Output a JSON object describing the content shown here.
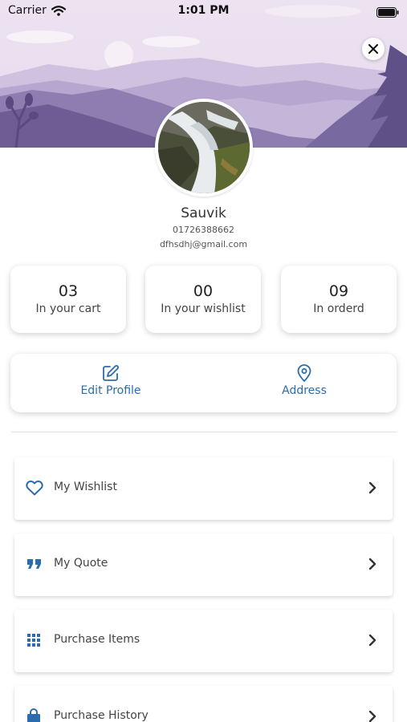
{
  "status_bar": {
    "carrier": "Carrier",
    "time": "1:01 PM",
    "icons": [
      "wifi-icon",
      "battery-icon"
    ]
  },
  "header": {
    "close_icon": "close-icon",
    "background": "mountain-landscape"
  },
  "profile": {
    "name": "Sauvik",
    "phone": "01726388662",
    "email": "dfhsdhj@gmail.com",
    "avatar": "waterfall-photo"
  },
  "stats": [
    {
      "count": "03",
      "label": "In your cart"
    },
    {
      "count": "00",
      "label": "In your wishlist"
    },
    {
      "count": "09",
      "label": "In orderd"
    }
  ],
  "actions": [
    {
      "label": "Edit Profile",
      "icon": "edit-icon"
    },
    {
      "label": "Address",
      "icon": "location-pin-icon"
    }
  ],
  "menu": [
    {
      "label": "My Wishlist",
      "icon": "heart-icon"
    },
    {
      "label": "My Quote",
      "icon": "quote-icon"
    },
    {
      "label": "Purchase Items",
      "icon": "grid-icon"
    },
    {
      "label": "Purchase History",
      "icon": "shopping-bag-icon"
    }
  ],
  "colors": {
    "accent": "#2b6cb0",
    "text": "#444444",
    "card_background": "#ffffff"
  }
}
